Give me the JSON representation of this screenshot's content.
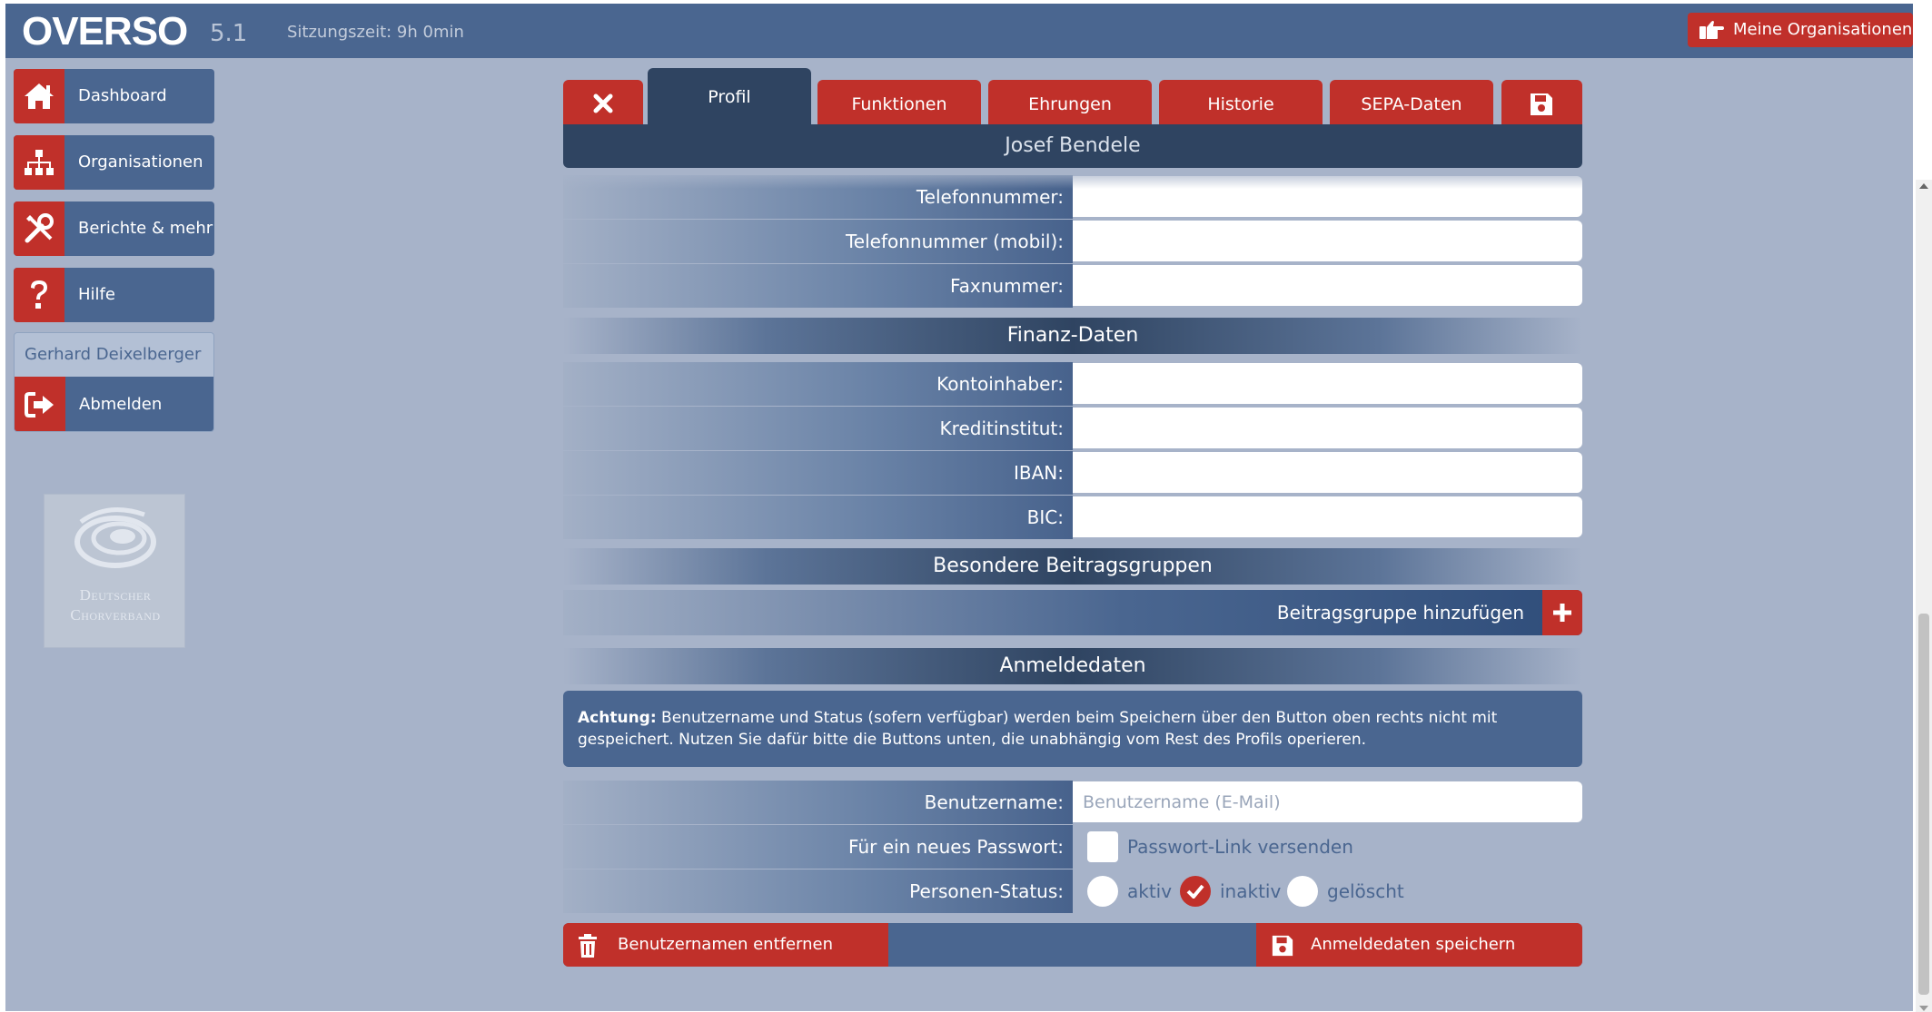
{
  "header": {
    "logo": "OVERSO",
    "version": "5.1",
    "session": "Sitzungszeit: 9h 0min",
    "my_orgs_label": "Meine Organisationen",
    "my_orgs_icon": "hand-pointing-icon"
  },
  "sidebar": {
    "items": [
      {
        "label": "Dashboard",
        "icon": "home-icon"
      },
      {
        "label": "Organisationen",
        "icon": "org-chart-icon"
      },
      {
        "label": "Berichte & mehr",
        "icon": "tools-icon"
      },
      {
        "label": "Hilfe",
        "icon": "question-icon"
      }
    ],
    "user_name": "Gerhard Deixelberger",
    "logout_label": "Abmelden",
    "logo_text": [
      "Deutscher",
      "Chorverband"
    ]
  },
  "tabs": {
    "close_icon": "close-icon",
    "items": [
      "Profil",
      "Funktionen",
      "Ehrungen",
      "Historie",
      "SEPA-Daten"
    ],
    "active": "Profil",
    "save_icon": "floppy-disk-icon"
  },
  "person_name": "Josef Bendele",
  "contact": {
    "phone_label": "Telefonnummer:",
    "phone_value": "",
    "mobile_label": "Telefonnummer (mobil):",
    "mobile_value": "",
    "fax_label": "Faxnummer:",
    "fax_value": ""
  },
  "finance": {
    "title": "Finanz-Daten",
    "holder_label": "Kontoinhaber:",
    "holder_value": "",
    "bank_label": "Kreditinstitut:",
    "bank_value": "",
    "iban_label": "IBAN:",
    "iban_value": "",
    "bic_label": "BIC:",
    "bic_value": ""
  },
  "groups": {
    "title": "Besondere Beitragsgruppen",
    "add_label": "Beitragsgruppe hinzufügen"
  },
  "login": {
    "title": "Anmeldedaten",
    "notice_bold": "Achtung:",
    "notice_text": " Benutzername und Status (sofern verfügbar) werden beim Speichern über den Button oben rechts nicht mit gespeichert. Nutzen Sie dafür bitte die Buttons unten, die unabhängig vom Rest des Profils operieren.",
    "username_label": "Benutzername:",
    "username_value": "",
    "username_placeholder": "Benutzername (E-Mail)",
    "password_label": "Für ein neues Passwort:",
    "password_option": "Passwort-Link versenden",
    "password_checked": false,
    "status_label": "Personen-Status:",
    "status_options": [
      "aktiv",
      "inaktiv",
      "gelöscht"
    ],
    "status_selected": "inaktiv",
    "remove_label": "Benutzernamen entfernen",
    "save_label": "Anmeldedaten speichern"
  },
  "colors": {
    "accent_red": "#c0302a",
    "primary_blue": "#4a6690",
    "dark_blue": "#2f4461",
    "background": "#a7b3c9"
  }
}
